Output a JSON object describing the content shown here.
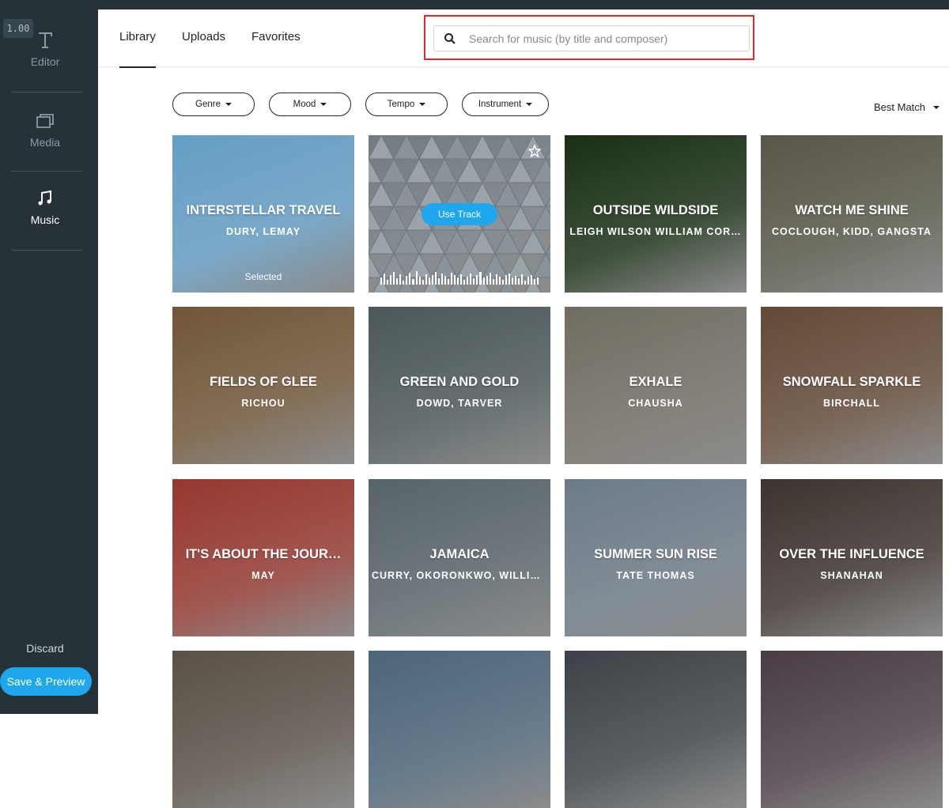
{
  "app": {
    "zoom": "1.00"
  },
  "sidebar": {
    "items": [
      {
        "label": "Editor",
        "icon": "text-icon"
      },
      {
        "label": "Media",
        "icon": "media-icon"
      },
      {
        "label": "Music",
        "icon": "music-note-icon",
        "active": true
      }
    ],
    "discard_label": "Discard",
    "save_label": "Save & Preview"
  },
  "header": {
    "tabs": [
      {
        "label": "Library",
        "active": true
      },
      {
        "label": "Uploads"
      },
      {
        "label": "Favorites"
      }
    ],
    "search": {
      "placeholder": "Search for music (by title and composer)",
      "value": ""
    }
  },
  "filters": [
    {
      "label": "Genre"
    },
    {
      "label": "Mood"
    },
    {
      "label": "Tempo"
    },
    {
      "label": "Instrument"
    }
  ],
  "sort": {
    "label": "Best Match"
  },
  "tracks": [
    {
      "title": "INTERSTELLAR TRAVEL",
      "artist": "DURY, LEMAY",
      "status": "Selected",
      "bg": "#7cc2f2"
    },
    {
      "title": "",
      "artist": "",
      "hover_action": "Use Track",
      "bg": "#8e979d"
    },
    {
      "title": "OUTSIDE WILDSIDE",
      "artist": "LEIGH WILSON WILLIAM COR…",
      "bg": "#1f3a1a"
    },
    {
      "title": "WATCH ME SHINE",
      "artist": "COCLOUGH, KIDD, GANGSTA",
      "bg": "#6b6a58"
    },
    {
      "title": "FIELDS OF GLEE",
      "artist": "RICHOU",
      "bg": "#8a6a45"
    },
    {
      "title": "GREEN AND GOLD",
      "artist": "DOWD, TARVER",
      "bg": "#5c6b6e"
    },
    {
      "title": "EXHALE",
      "artist": "CHAUSHA",
      "bg": "#8b8578"
    },
    {
      "title": "SNOWFALL SPARKLE",
      "artist": "BIRCHALL",
      "bg": "#7a5a43"
    },
    {
      "title": "IT'S ABOUT THE JOUR…",
      "artist": "MAY",
      "bg": "#b7443a"
    },
    {
      "title": "JAMAICA",
      "artist": "CURRY, OKORONKWO, WILLIA…",
      "bg": "#6b7a82"
    },
    {
      "title": "SUMMER SUN RISE",
      "artist": "TATE THOMAS",
      "bg": "#8596a6"
    },
    {
      "title": "OVER THE INFLUENCE",
      "artist": "SHANAHAN",
      "bg": "#4b3f3a"
    },
    {
      "title": "",
      "artist": "",
      "bg": "#6e6357"
    },
    {
      "title": "",
      "artist": "",
      "bg": "#5d7c95"
    },
    {
      "title": "",
      "artist": "",
      "bg": "#4a5157"
    },
    {
      "title": "",
      "artist": "",
      "bg": "#5a4a55"
    }
  ]
}
